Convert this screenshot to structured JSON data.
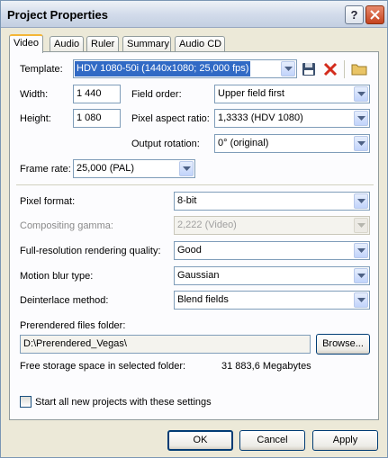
{
  "window": {
    "title": "Project Properties",
    "help_button": "?",
    "close_button": "×"
  },
  "tabs": [
    {
      "label": "Video",
      "active": true
    },
    {
      "label": "Audio"
    },
    {
      "label": "Ruler"
    },
    {
      "label": "Summary"
    },
    {
      "label": "Audio CD"
    }
  ],
  "template": {
    "label": "Template:",
    "value": "HDV 1080-50i (1440x1080; 25,000 fps)"
  },
  "width": {
    "label": "Width:",
    "value": "1 440"
  },
  "height": {
    "label": "Height:",
    "value": "1 080"
  },
  "field_order": {
    "label": "Field order:",
    "value": "Upper field first"
  },
  "pixel_aspect_ratio": {
    "label": "Pixel aspect ratio:",
    "value": "1,3333 (HDV 1080)"
  },
  "output_rotation": {
    "label": "Output rotation:",
    "value": "0° (original)"
  },
  "frame_rate": {
    "label": "Frame rate:",
    "value": "25,000 (PAL)"
  },
  "pixel_format": {
    "label": "Pixel format:",
    "value": "8-bit"
  },
  "compositing_gamma": {
    "label": "Compositing gamma:",
    "value": "2,222 (Video)",
    "enabled": false
  },
  "rendering_quality": {
    "label": "Full-resolution rendering quality:",
    "value": "Good"
  },
  "motion_blur": {
    "label": "Motion blur type:",
    "value": "Gaussian"
  },
  "deinterlace": {
    "label": "Deinterlace method:",
    "value": "Blend fields"
  },
  "prerender": {
    "label": "Prerendered files folder:",
    "path": "D:\\Prerendered_Vegas\\",
    "browse_label": "Browse..."
  },
  "storage": {
    "label": "Free storage space in selected folder:",
    "value": "31 883,6 Megabytes"
  },
  "start_new": {
    "label": "Start all new projects with these settings",
    "checked": false
  },
  "footer": {
    "ok_label": "OK",
    "cancel_label": "Cancel",
    "apply_label": "Apply"
  }
}
